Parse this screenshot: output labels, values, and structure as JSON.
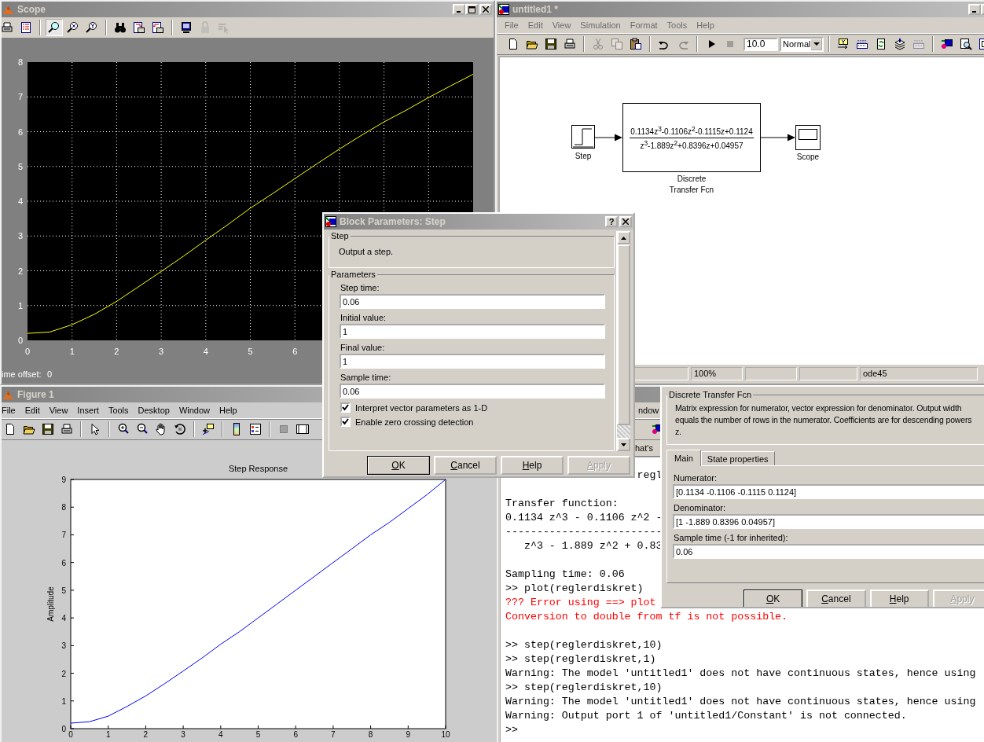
{
  "scope_window": {
    "title": "Scope",
    "toolbar": [
      {
        "kind": "print",
        "selected": false,
        "disabled": false
      },
      {
        "kind": "params",
        "selected": false,
        "disabled": false
      },
      {
        "kind": "zoom",
        "selected": true,
        "disabled": false
      },
      {
        "kind": "zoomx",
        "selected": false,
        "disabled": false
      },
      {
        "kind": "zoomy",
        "selected": false,
        "disabled": false
      },
      {
        "kind": "binoculars",
        "selected": false,
        "disabled": false
      },
      {
        "kind": "saveaxes",
        "selected": false,
        "disabled": false
      },
      {
        "kind": "restoreaxes",
        "selected": false,
        "disabled": false
      },
      {
        "kind": "floating",
        "selected": false,
        "disabled": false
      },
      {
        "kind": "lock",
        "selected": false,
        "disabled": true
      },
      {
        "kind": "selector",
        "selected": false,
        "disabled": true
      }
    ],
    "chart_data": {
      "type": "line",
      "x": [
        0,
        0.5,
        1,
        1.5,
        2,
        2.5,
        3,
        3.5,
        4,
        4.5,
        5,
        5.5,
        6,
        6.5,
        7,
        7.5,
        8,
        8.5,
        9,
        9.5,
        10
      ],
      "series": [
        {
          "color": "#ffff00",
          "values": [
            0.2,
            0.24,
            0.45,
            0.75,
            1.12,
            1.55,
            1.98,
            2.42,
            2.88,
            3.33,
            3.8,
            4.22,
            4.65,
            5.08,
            5.5,
            5.9,
            6.28,
            6.62,
            6.98,
            7.32,
            7.65
          ]
        }
      ],
      "xlim": [
        0,
        10
      ],
      "ylim": [
        0,
        8
      ],
      "xticks": [
        0,
        1,
        2,
        3,
        4,
        5,
        6
      ],
      "yticks": [
        0,
        1,
        2,
        3,
        4,
        5,
        6,
        7,
        8
      ],
      "grid": true
    },
    "time_offset_label": "ime offset:",
    "time_offset_value": "0"
  },
  "simulink_window": {
    "title": "untitled1 *",
    "menu": [
      "File",
      "Edit",
      "View",
      "Simulation",
      "Format",
      "Tools",
      "Help"
    ],
    "toolbar_groups": [
      [
        {
          "kind": "new",
          "disabled": false
        },
        {
          "kind": "open",
          "disabled": false
        },
        {
          "kind": "save",
          "disabled": false
        },
        {
          "kind": "print",
          "disabled": false
        }
      ],
      [
        {
          "kind": "cut",
          "disabled": true
        },
        {
          "kind": "copy",
          "disabled": true
        },
        {
          "kind": "paste",
          "disabled": false
        }
      ],
      [
        {
          "kind": "undo",
          "disabled": false
        },
        {
          "kind": "redo",
          "disabled": true
        }
      ],
      [
        {
          "kind": "play",
          "disabled": false
        },
        {
          "kind": "stop",
          "disabled": true
        },
        {
          "kind": "field",
          "value": "10.0"
        },
        {
          "kind": "dropdown",
          "value": "Normal"
        }
      ],
      [
        {
          "kind": "library",
          "disabled": false
        },
        {
          "kind": "keyboard",
          "disabled": false
        },
        {
          "kind": "refresh",
          "disabled": false
        },
        {
          "kind": "stack",
          "disabled": false
        },
        {
          "kind": "keyboard",
          "disabled": true
        }
      ],
      [
        {
          "kind": "diagram",
          "disabled": false
        },
        {
          "kind": "inspect",
          "disabled": false
        },
        {
          "kind": "panel",
          "disabled": false
        }
      ]
    ],
    "blocks": [
      {
        "kind": "step",
        "label": "Step"
      },
      {
        "kind": "transfer",
        "numerator": "0.1134z$^{3}$-0.1106z$^{2}$-0.1115z+0.1124",
        "denominator": "z$^{3}$-1.889z$^{2}$+0.8396z+0.04957",
        "label": "Discrete\nTransfer Fcn"
      },
      {
        "kind": "scope",
        "label": "Scope"
      }
    ],
    "status_bar": {
      "zoom": "100%",
      "solver": "ode45"
    }
  },
  "figure_window": {
    "title": "Figure 1",
    "menu": [
      "File",
      "Edit",
      "View",
      "Insert",
      "Tools",
      "Desktop",
      "Window",
      "Help"
    ],
    "toolbar_groups": [
      [
        {
          "kind": "new"
        },
        {
          "kind": "open"
        },
        {
          "kind": "save"
        },
        {
          "kind": "print"
        }
      ],
      [
        {
          "kind": "pointer"
        }
      ],
      [
        {
          "kind": "zoomin"
        },
        {
          "kind": "zoomout"
        },
        {
          "kind": "pan"
        },
        {
          "kind": "rotate"
        }
      ],
      [
        {
          "kind": "datacursor"
        }
      ],
      [
        {
          "kind": "colorbar"
        },
        {
          "kind": "legend"
        }
      ],
      [
        {
          "kind": "hidetools"
        },
        {
          "kind": "showtools"
        }
      ]
    ],
    "chart_data": {
      "type": "line",
      "title": "Step Response",
      "ylabel": "Amplitude",
      "x": [
        0,
        0.5,
        1,
        1.5,
        2,
        2.5,
        3,
        3.5,
        4,
        4.5,
        5,
        5.5,
        6,
        6.5,
        7,
        7.5,
        8,
        8.5,
        9,
        9.5,
        10
      ],
      "series": [
        {
          "color": "#0000ff",
          "values": [
            0.2,
            0.25,
            0.45,
            0.8,
            1.18,
            1.62,
            2.08,
            2.55,
            3.05,
            3.5,
            4.0,
            4.5,
            5.0,
            5.5,
            6.0,
            6.5,
            7.0,
            7.45,
            7.95,
            8.45,
            9.0
          ]
        }
      ],
      "xlim": [
        0,
        10
      ],
      "ylim": [
        0,
        9
      ],
      "xticks": [
        0,
        1,
        2,
        3,
        4,
        5,
        6,
        7,
        8,
        9,
        10
      ],
      "yticks": [
        0,
        1,
        2,
        3,
        4,
        5,
        6,
        7,
        8,
        9
      ]
    }
  },
  "command_window": {
    "menu_fragment": "ndow",
    "shortcut_fragment": "hat's",
    "lines": [
      {
        "kind": "partial",
        "text": "regl"
      },
      {
        "kind": "blank"
      },
      {
        "kind": "plain",
        "text": "Transfer function:"
      },
      {
        "kind": "plain",
        "text": "0.1134 z^3 - 0.1106 z^2 -"
      },
      {
        "kind": "plain",
        "text": "-------------------------"
      },
      {
        "kind": "plain",
        "text": "   z^3 - 1.889 z^2 + 0.83"
      },
      {
        "kind": "blank"
      },
      {
        "kind": "plain",
        "text": "Sampling time: 0.06"
      },
      {
        "kind": "plain",
        "text": ">> plot(reglerdiskret)"
      },
      {
        "kind": "error",
        "text": "??? Error using ==> plot"
      },
      {
        "kind": "error",
        "text": "Conversion to double from tf is not possible."
      },
      {
        "kind": "blank"
      },
      {
        "kind": "plain",
        "text": ">> step(reglerdiskret,10)"
      },
      {
        "kind": "plain",
        "text": ">> step(reglerdiskret,1)"
      },
      {
        "kind": "plain",
        "text": "Warning: The model 'untitled1' does not have continuous states, hence using"
      },
      {
        "kind": "plain",
        "text": ">> step(reglerdiskret,10)"
      },
      {
        "kind": "plain",
        "text": "Warning: The model 'untitled1' does not have continuous states, hence using"
      },
      {
        "kind": "plain",
        "text": "Warning: Output port 1 of 'untitled1/Constant' is not connected."
      },
      {
        "kind": "plain",
        "text": ">>"
      }
    ]
  },
  "block_parameters_dialog": {
    "title": "Block Parameters: Step",
    "help_glyph": "?",
    "section": "Step",
    "description": "Output a step.",
    "parameters_label": "Parameters",
    "fields": [
      {
        "label": "Step time:",
        "value": "0.06"
      },
      {
        "label": "Initial value:",
        "value": "1"
      },
      {
        "label": "Final value:",
        "value": "1"
      },
      {
        "label": "Sample time:",
        "value": "0.06"
      }
    ],
    "checkboxes": [
      {
        "label": "Interpret vector parameters as 1-D",
        "checked": true
      },
      {
        "label": "Enable zero crossing detection",
        "checked": true
      }
    ],
    "buttons": [
      {
        "label": "OK",
        "default": true,
        "disabled": false
      },
      {
        "label": "Cancel",
        "default": false,
        "disabled": false
      },
      {
        "label": "Help",
        "default": false,
        "disabled": false
      },
      {
        "label": "Apply",
        "default": false,
        "disabled": true
      }
    ]
  },
  "transfer_fcn_dialog": {
    "section": "Discrete Transfer Fcn",
    "description": "Matrix expression for numerator, vector expression for denominator. Output width\nequals the number of rows in the numerator.  Coefficients are for descending powers\nz.",
    "tabs": [
      {
        "label": "Main",
        "selected": true
      },
      {
        "label": "State properties",
        "selected": false
      }
    ],
    "fields": [
      {
        "label": "Numerator:",
        "value": "[0.1134 -0.1106 -0.1115 0.1124]"
      },
      {
        "label": "Denominator:",
        "value": "[1 -1.889 0.8396 0.04957]"
      },
      {
        "label": "Sample time (-1 for inherited):",
        "value": "0.06"
      }
    ],
    "buttons": [
      {
        "label": "OK",
        "default": true,
        "disabled": false
      },
      {
        "label": "Cancel",
        "default": false,
        "disabled": false
      },
      {
        "label": "Help",
        "default": false,
        "disabled": false
      },
      {
        "label": "Apply",
        "default": false,
        "disabled": true
      }
    ]
  }
}
